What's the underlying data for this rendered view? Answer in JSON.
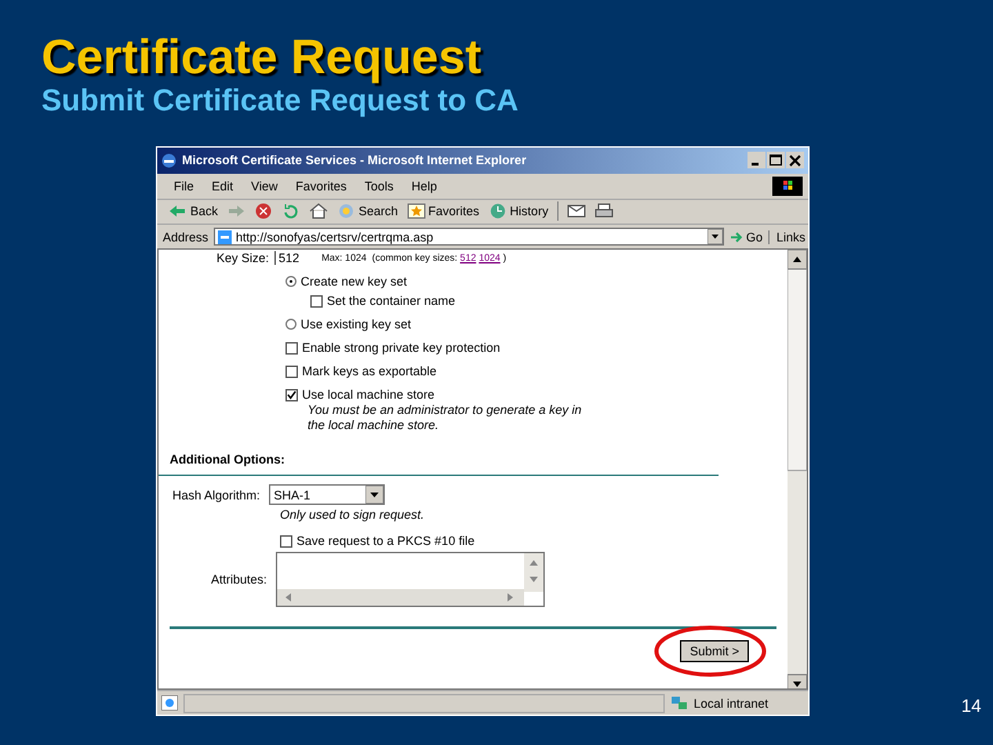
{
  "slide": {
    "title": "Certificate Request",
    "subtitle": "Submit Certificate Request to CA",
    "page_number": "14"
  },
  "window": {
    "title": "Microsoft Certificate Services - Microsoft Internet Explorer"
  },
  "menu": [
    "File",
    "Edit",
    "View",
    "Favorites",
    "Tools",
    "Help"
  ],
  "toolbar": [
    {
      "kind": "back",
      "label": "Back"
    },
    {
      "kind": "forward"
    },
    {
      "kind": "stop"
    },
    {
      "kind": "refresh"
    },
    {
      "kind": "home"
    },
    {
      "kind": "search",
      "label": "Search"
    },
    {
      "kind": "favorites",
      "label": "Favorites"
    },
    {
      "kind": "history",
      "label": "History"
    },
    {
      "kind": "mail"
    },
    {
      "kind": "print"
    }
  ],
  "address": {
    "label": "Address",
    "value": "http://sonofyas/certsrv/certrqma.asp",
    "go": "Go",
    "links": "Links"
  },
  "key_size": {
    "label": "Key Size:",
    "value": "512",
    "max": "Max: 1024",
    "hint": "(common key sizes:",
    "links": [
      "512",
      "1024"
    ],
    "hint_end": ")"
  },
  "options": [
    {
      "kind": "radio",
      "label": "Create new key set",
      "selected": true,
      "children": [
        {
          "kind": "checkbox",
          "label": "Set the container name",
          "checked": false
        }
      ]
    },
    {
      "kind": "radio",
      "label": "Use existing key set",
      "selected": false
    },
    {
      "kind": "checkbox",
      "label": "Enable strong private key protection",
      "checked": false
    },
    {
      "kind": "checkbox",
      "label": "Mark keys as exportable",
      "checked": false
    },
    {
      "kind": "checkbox",
      "label": "Use local machine store",
      "checked": true,
      "note": "You must be an administrator to generate a key in the local machine store."
    }
  ],
  "additional": {
    "heading": "Additional Options:",
    "hash_label": "Hash Algorithm:",
    "hash_value": "SHA-1",
    "hash_note": "Only used to sign request.",
    "save": {
      "label": "Save request to a PKCS #10 file",
      "checked": false
    },
    "attributes_label": "Attributes:"
  },
  "submit": {
    "label": "Submit >",
    "highlighted": true
  },
  "status_bar": {
    "zone": "Local intranet"
  }
}
